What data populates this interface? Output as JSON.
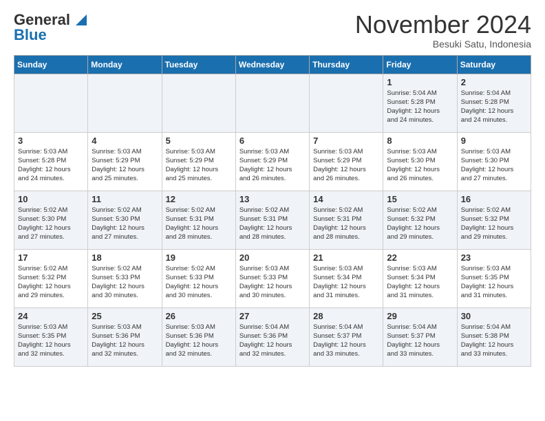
{
  "logo": {
    "line1": "General",
    "line2": "Blue"
  },
  "title": "November 2024",
  "location": "Besuki Satu, Indonesia",
  "weekdays": [
    "Sunday",
    "Monday",
    "Tuesday",
    "Wednesday",
    "Thursday",
    "Friday",
    "Saturday"
  ],
  "weeks": [
    [
      {
        "day": "",
        "info": ""
      },
      {
        "day": "",
        "info": ""
      },
      {
        "day": "",
        "info": ""
      },
      {
        "day": "",
        "info": ""
      },
      {
        "day": "",
        "info": ""
      },
      {
        "day": "1",
        "info": "Sunrise: 5:04 AM\nSunset: 5:28 PM\nDaylight: 12 hours\nand 24 minutes."
      },
      {
        "day": "2",
        "info": "Sunrise: 5:04 AM\nSunset: 5:28 PM\nDaylight: 12 hours\nand 24 minutes."
      }
    ],
    [
      {
        "day": "3",
        "info": "Sunrise: 5:03 AM\nSunset: 5:28 PM\nDaylight: 12 hours\nand 24 minutes."
      },
      {
        "day": "4",
        "info": "Sunrise: 5:03 AM\nSunset: 5:29 PM\nDaylight: 12 hours\nand 25 minutes."
      },
      {
        "day": "5",
        "info": "Sunrise: 5:03 AM\nSunset: 5:29 PM\nDaylight: 12 hours\nand 25 minutes."
      },
      {
        "day": "6",
        "info": "Sunrise: 5:03 AM\nSunset: 5:29 PM\nDaylight: 12 hours\nand 26 minutes."
      },
      {
        "day": "7",
        "info": "Sunrise: 5:03 AM\nSunset: 5:29 PM\nDaylight: 12 hours\nand 26 minutes."
      },
      {
        "day": "8",
        "info": "Sunrise: 5:03 AM\nSunset: 5:30 PM\nDaylight: 12 hours\nand 26 minutes."
      },
      {
        "day": "9",
        "info": "Sunrise: 5:03 AM\nSunset: 5:30 PM\nDaylight: 12 hours\nand 27 minutes."
      }
    ],
    [
      {
        "day": "10",
        "info": "Sunrise: 5:02 AM\nSunset: 5:30 PM\nDaylight: 12 hours\nand 27 minutes."
      },
      {
        "day": "11",
        "info": "Sunrise: 5:02 AM\nSunset: 5:30 PM\nDaylight: 12 hours\nand 27 minutes."
      },
      {
        "day": "12",
        "info": "Sunrise: 5:02 AM\nSunset: 5:31 PM\nDaylight: 12 hours\nand 28 minutes."
      },
      {
        "day": "13",
        "info": "Sunrise: 5:02 AM\nSunset: 5:31 PM\nDaylight: 12 hours\nand 28 minutes."
      },
      {
        "day": "14",
        "info": "Sunrise: 5:02 AM\nSunset: 5:31 PM\nDaylight: 12 hours\nand 28 minutes."
      },
      {
        "day": "15",
        "info": "Sunrise: 5:02 AM\nSunset: 5:32 PM\nDaylight: 12 hours\nand 29 minutes."
      },
      {
        "day": "16",
        "info": "Sunrise: 5:02 AM\nSunset: 5:32 PM\nDaylight: 12 hours\nand 29 minutes."
      }
    ],
    [
      {
        "day": "17",
        "info": "Sunrise: 5:02 AM\nSunset: 5:32 PM\nDaylight: 12 hours\nand 29 minutes."
      },
      {
        "day": "18",
        "info": "Sunrise: 5:02 AM\nSunset: 5:33 PM\nDaylight: 12 hours\nand 30 minutes."
      },
      {
        "day": "19",
        "info": "Sunrise: 5:02 AM\nSunset: 5:33 PM\nDaylight: 12 hours\nand 30 minutes."
      },
      {
        "day": "20",
        "info": "Sunrise: 5:03 AM\nSunset: 5:33 PM\nDaylight: 12 hours\nand 30 minutes."
      },
      {
        "day": "21",
        "info": "Sunrise: 5:03 AM\nSunset: 5:34 PM\nDaylight: 12 hours\nand 31 minutes."
      },
      {
        "day": "22",
        "info": "Sunrise: 5:03 AM\nSunset: 5:34 PM\nDaylight: 12 hours\nand 31 minutes."
      },
      {
        "day": "23",
        "info": "Sunrise: 5:03 AM\nSunset: 5:35 PM\nDaylight: 12 hours\nand 31 minutes."
      }
    ],
    [
      {
        "day": "24",
        "info": "Sunrise: 5:03 AM\nSunset: 5:35 PM\nDaylight: 12 hours\nand 32 minutes."
      },
      {
        "day": "25",
        "info": "Sunrise: 5:03 AM\nSunset: 5:36 PM\nDaylight: 12 hours\nand 32 minutes."
      },
      {
        "day": "26",
        "info": "Sunrise: 5:03 AM\nSunset: 5:36 PM\nDaylight: 12 hours\nand 32 minutes."
      },
      {
        "day": "27",
        "info": "Sunrise: 5:04 AM\nSunset: 5:36 PM\nDaylight: 12 hours\nand 32 minutes."
      },
      {
        "day": "28",
        "info": "Sunrise: 5:04 AM\nSunset: 5:37 PM\nDaylight: 12 hours\nand 33 minutes."
      },
      {
        "day": "29",
        "info": "Sunrise: 5:04 AM\nSunset: 5:37 PM\nDaylight: 12 hours\nand 33 minutes."
      },
      {
        "day": "30",
        "info": "Sunrise: 5:04 AM\nSunset: 5:38 PM\nDaylight: 12 hours\nand 33 minutes."
      }
    ]
  ]
}
